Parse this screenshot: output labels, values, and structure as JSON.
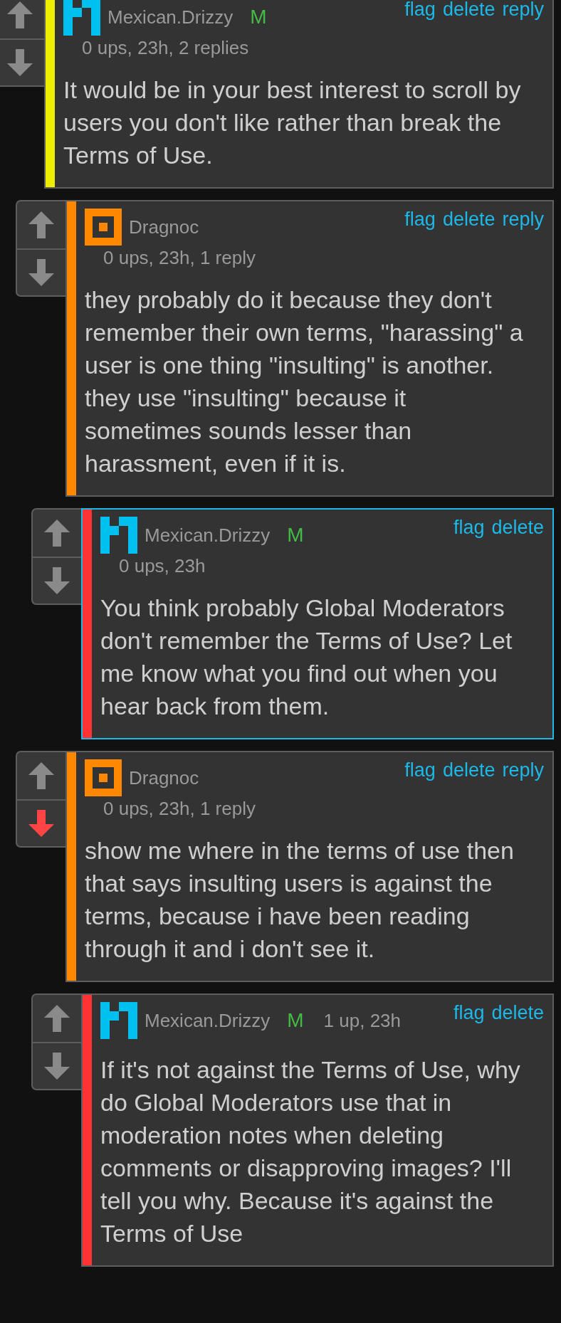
{
  "comments": [
    {
      "author": "Mexican.Drizzy",
      "avatar": {
        "kind": "m-pixel"
      },
      "badge": "M",
      "color": "#eeee00",
      "meta": "0 ups, 23h, 2 replies",
      "meta_inline": false,
      "actions": [
        "flag",
        "delete",
        "reply"
      ],
      "highlighted": false,
      "downvoted": false,
      "body": "It would be in your best interest to scroll by users you don't like rather than break the Terms of Use.",
      "children": [
        {
          "author": "Dragnoc",
          "avatar": {
            "kind": "square"
          },
          "color": "#ff8800",
          "meta": "0 ups, 23h, 1 reply",
          "meta_inline": false,
          "actions": [
            "flag",
            "delete",
            "reply"
          ],
          "highlighted": false,
          "downvoted": false,
          "body": "they probably do it because they don't remember their own terms, \"harassing\" a user is one thing \"insulting\" is another. they use \"insulting\" because it sometimes sounds lesser than harassment, even if it is.",
          "children": [
            {
              "author": "Mexican.Drizzy",
              "avatar": {
                "kind": "m-pixel"
              },
              "badge": "M",
              "color": "#ff3333",
              "meta": "0 ups, 23h",
              "meta_inline": false,
              "actions": [
                "flag",
                "delete"
              ],
              "highlighted": true,
              "downvoted": false,
              "body": "You think probably Global Moderators don't remember the Terms of Use? Let me know what you find out when you hear back from them."
            }
          ]
        },
        {
          "author": "Dragnoc",
          "avatar": {
            "kind": "square"
          },
          "color": "#ff8800",
          "meta": "0 ups, 23h, 1 reply",
          "meta_inline": false,
          "actions": [
            "flag",
            "delete",
            "reply"
          ],
          "highlighted": false,
          "downvoted": true,
          "body": "show me where in the terms of use then that says insulting users is against the terms, because i have been reading through it and i don't see it.",
          "children": [
            {
              "author": "Mexican.Drizzy",
              "avatar": {
                "kind": "m-pixel"
              },
              "badge": "M",
              "color": "#ff3333",
              "meta": "1 up, 23h",
              "meta_inline": true,
              "actions": [
                "flag",
                "delete"
              ],
              "highlighted": false,
              "downvoted": false,
              "body": "If it's not against the Terms of Use, why do Global Moderators use that in moderation notes when deleting comments or disapproving images? I'll tell you why. Because it's against the Terms of Use"
            }
          ]
        }
      ]
    }
  ]
}
